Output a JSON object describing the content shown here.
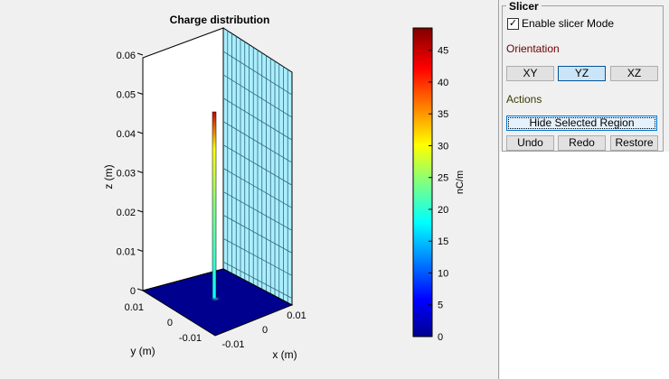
{
  "plot": {
    "title": "Charge distribution",
    "zlabel": "z (m)",
    "ylabel": "y (m)",
    "xlabel": "x (m)",
    "zticks": [
      "0",
      "0.01",
      "0.02",
      "0.03",
      "0.04",
      "0.05",
      "0.06"
    ],
    "yticks": [
      "0.01",
      "0",
      "-0.01"
    ],
    "xticks": [
      "-0.01",
      "0",
      "0.01"
    ]
  },
  "colorbar": {
    "label": "nC/m",
    "ticks": [
      "0",
      "5",
      "10",
      "15",
      "20",
      "25",
      "30",
      "35",
      "40",
      "45"
    ],
    "max": 48.5
  },
  "slicer": {
    "title": "Slicer",
    "enable_label": "Enable slicer Mode",
    "enabled": true,
    "orientation_label": "Orientation",
    "orientations": [
      "XY",
      "YZ",
      "XZ"
    ],
    "selected": "YZ",
    "actions_label": "Actions",
    "hide_label": "Hide Selected Region",
    "undo": "Undo",
    "redo": "Redo",
    "restore": "Restore"
  }
}
